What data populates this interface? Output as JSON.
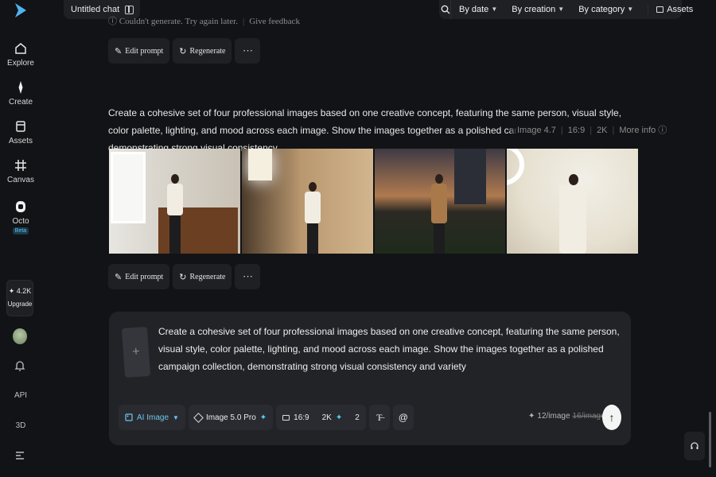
{
  "sidebar": {
    "logo_icon": "brand-logo-icon",
    "items": [
      {
        "label": "Explore",
        "icon": "home-icon"
      },
      {
        "label": "Create",
        "icon": "sparkle-icon"
      },
      {
        "label": "Assets",
        "icon": "folder-icon"
      },
      {
        "label": "Canvas",
        "icon": "grid-frame-icon"
      },
      {
        "label": "Octo",
        "icon": "octo-icon",
        "badge": "Beta"
      }
    ],
    "upgrade": {
      "credits": "✦ 4.2K",
      "label": "Upgrade"
    },
    "bottom": {
      "bell_icon": "bell-icon",
      "api": "API",
      "threed": "3D",
      "menu_icon": "menu-icon"
    }
  },
  "topbar": {
    "chat_title": "Untitled chat",
    "filters": {
      "by_date": "By date",
      "by_creation": "By creation",
      "by_category": "By category",
      "assets": "Assets"
    }
  },
  "previous": {
    "error_text": "Couldn't generate. Try again later.",
    "feedback": "Give feedback"
  },
  "actions": {
    "edit_prompt": "Edit prompt",
    "regenerate": "Regenerate",
    "more": "···"
  },
  "generation": {
    "prompt": "Create a cohesive set of four professional images based on one creative concept, featuring the same person, visual style, color palette, lighting, and mood across each image. Show the images together as a polished campaign collection, demonstrating strong visual consistency",
    "model": "Image 4.7",
    "ratio": "16:9",
    "resolution": "2K",
    "more_info": "More info ⓘ",
    "images": [
      {
        "alt": "Woman in white blazer standing by window and wooden desk"
      },
      {
        "alt": "Woman seated on chair in studio with softbox light"
      },
      {
        "alt": "Woman in camel coat on evening street with city lights"
      },
      {
        "alt": "Woman in white blazer against cream wall with ring light"
      }
    ]
  },
  "composer": {
    "text": "Create a cohesive set of four professional images based on one creative concept, featuring the same person, visual style, color palette, lighting, and mood across each image. Show the images together as a polished campaign collection, demonstrating strong visual consistency and variety",
    "mode": "AI Image",
    "model": "Image 5.0 Pro",
    "ratio": "16:9",
    "resolution": "2K",
    "count": "2",
    "cost": "12/image",
    "cost_old": "16/image",
    "send_icon": "arrow-up-icon"
  },
  "help_icon": "headset-icon"
}
